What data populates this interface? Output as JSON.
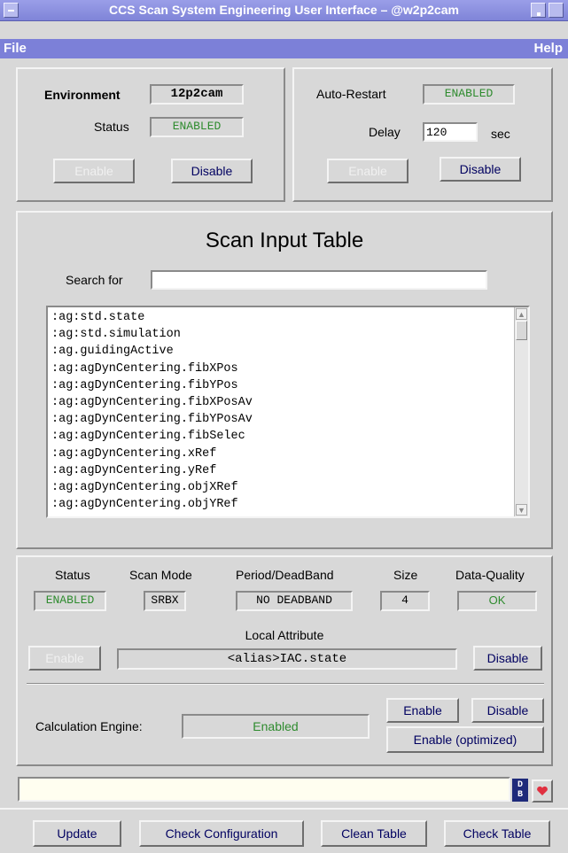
{
  "window": {
    "title": "CCS Scan System Engineering User Interface – @w2p2cam"
  },
  "menu": {
    "file": "File",
    "help": "Help"
  },
  "environment": {
    "env_label": "Environment",
    "env_value": "12p2cam",
    "status_label": "Status",
    "status_value": "ENABLED",
    "enable_label": "Enable",
    "disable_label": "Disable"
  },
  "auto_restart": {
    "label": "Auto-Restart",
    "value": "ENABLED",
    "delay_label": "Delay",
    "delay_value": "120",
    "delay_unit": "sec",
    "enable_label": "Enable",
    "disable_label": "Disable"
  },
  "scan_table": {
    "title": "Scan Input Table",
    "search_label": "Search for",
    "search_value": "",
    "items": [
      ":ag:std.state",
      ":ag:std.simulation",
      ":ag.guidingActive",
      ":ag:agDynCentering.fibXPos",
      ":ag:agDynCentering.fibYPos",
      ":ag:agDynCentering.fibXPosAv",
      ":ag:agDynCentering.fibYPosAv",
      ":ag:agDynCentering.fibSelec",
      ":ag:agDynCentering.xRef",
      ":ag:agDynCentering.yRef",
      ":ag:agDynCentering.objXRef",
      ":ag:agDynCentering.objYRef"
    ]
  },
  "details": {
    "status_label": "Status",
    "status_value": "ENABLED",
    "scan_mode_label": "Scan Mode",
    "scan_mode_value": "SRBX",
    "period_label": "Period/DeadBand",
    "period_value": "NO DEADBAND",
    "size_label": "Size",
    "size_value": "4",
    "quality_label": "Data-Quality",
    "quality_value": "OK",
    "local_attr_label": "Local Attribute",
    "local_attr_value": "<alias>IAC.state",
    "enable_label": "Enable",
    "disable_label": "Disable"
  },
  "calc_engine": {
    "label": "Calculation Engine:",
    "value": "Enabled",
    "enable_label": "Enable",
    "disable_label": "Disable",
    "enable_opt_label": "Enable (optimized)"
  },
  "statusbar": {
    "message": "",
    "db_icon_text": "DB"
  },
  "bottom_buttons": {
    "update": "Update",
    "check_config": "Check Configuration",
    "clean_table": "Clean Table",
    "check_table": "Check Table"
  },
  "colors": {
    "titlebar": "#8a8ee0",
    "menubar": "#7c80d8",
    "enabled_text": "#2e8b2e",
    "background": "#d8d8d8"
  }
}
